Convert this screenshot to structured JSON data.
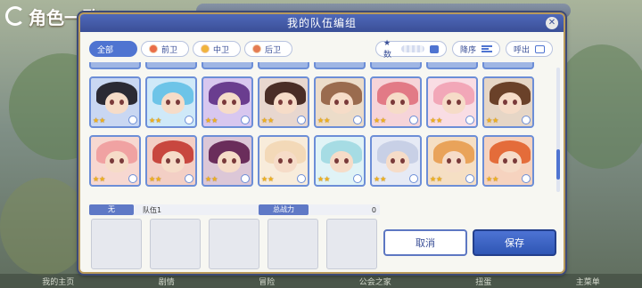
{
  "background": {
    "title": "角色一覧",
    "bottom_nav": [
      "我的主页",
      "剧情",
      "冒险",
      "公会之家",
      "扭蛋",
      "主菜单"
    ]
  },
  "dialog": {
    "title": "我的队伍编组",
    "filters": [
      {
        "label": "全部",
        "active": true
      },
      {
        "label": "前卫",
        "active": false
      },
      {
        "label": "中卫",
        "active": false
      },
      {
        "label": "后卫",
        "active": false
      }
    ],
    "sort_field": "★数",
    "sort_order": "降序",
    "call_out": "呼出"
  },
  "characters": [
    {
      "hair": "#2b2a34",
      "bg": "#c9d7f2"
    },
    {
      "hair": "#6dc4e8",
      "bg": "#cfe9f8"
    },
    {
      "hair": "#6a3d8f",
      "bg": "#d8c7ef"
    },
    {
      "hair": "#4a2d26",
      "bg": "#e8d7cf"
    },
    {
      "hair": "#9a6b4e",
      "bg": "#ecdcc9"
    },
    {
      "hair": "#e27a86",
      "bg": "#f6d4d9"
    },
    {
      "hair": "#f2a7b8",
      "bg": "#f9dde4"
    },
    {
      "hair": "#6a4129",
      "bg": "#e6d6c6"
    },
    {
      "hair": "#f0a2a2",
      "bg": "#f7d8d1"
    },
    {
      "hair": "#c8473f",
      "bg": "#f3cfc5"
    },
    {
      "hair": "#6a2d5b",
      "bg": "#dcc7d7"
    },
    {
      "hair": "#f3d9b8",
      "bg": "#f8ecdb"
    },
    {
      "hair": "#a6dce4",
      "bg": "#e0f3f6"
    },
    {
      "hair": "#c8d0e6",
      "bg": "#e6eaf5"
    },
    {
      "hair": "#e9a35a",
      "bg": "#f5dfc4"
    },
    {
      "hair": "#e46c3a",
      "bg": "#f6d3bf"
    }
  ],
  "team": {
    "none_label": "无",
    "name": "队伍1",
    "power_label": "总战力",
    "power_value": "0"
  },
  "buttons": {
    "cancel": "取消",
    "save": "保存"
  }
}
